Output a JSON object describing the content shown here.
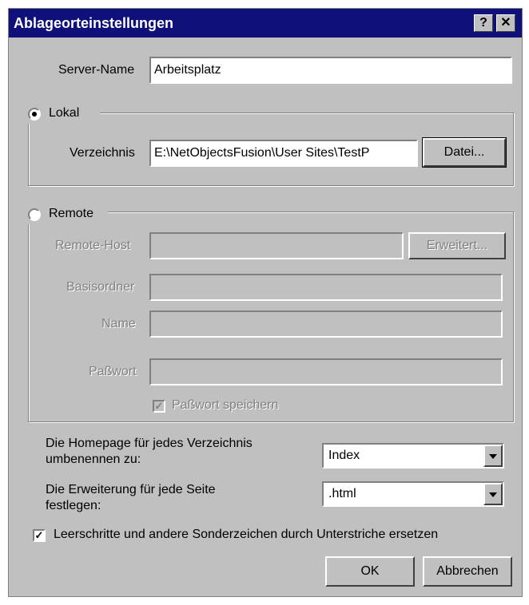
{
  "window": {
    "title": "Ablageorteinstellungen",
    "help_btn": "?",
    "close_btn": "✕"
  },
  "server": {
    "label": "Server-Name",
    "value": "Arbeitsplatz"
  },
  "local": {
    "radio_label": "Lokal",
    "selected": true,
    "dir_label": "Verzeichnis",
    "dir_value": "E:\\NetObjectsFusion\\User Sites\\TestP",
    "browse_btn": "Datei..."
  },
  "remote": {
    "radio_label": "Remote",
    "selected": false,
    "host_label": "Remote-Host",
    "host_value": "",
    "advanced_btn": "Erweitert...",
    "base_label": "Basisordner",
    "base_value": "",
    "name_label": "Name",
    "name_value": "",
    "password_label": "Paßwort",
    "password_value": "",
    "save_pw_label": "Paßwort speichern",
    "save_pw_checked": true
  },
  "homepage": {
    "label_line1": "Die Homepage für jedes Verzeichnis",
    "label_line2": "umbenennen zu:",
    "value": "Index"
  },
  "extension": {
    "label_line1": "Die Erweiterung für jede Seite",
    "label_line2": "festlegen:",
    "value": ".html"
  },
  "replace": {
    "label": "Leerschritte und andere Sonderzeichen durch Unterstriche ersetzen",
    "checked": true
  },
  "buttons": {
    "ok": "OK",
    "cancel": "Abbrechen"
  }
}
